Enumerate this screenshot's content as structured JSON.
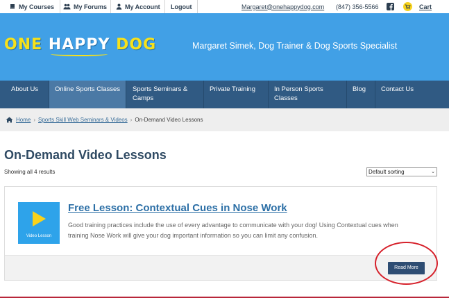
{
  "topbar": {
    "my_courses": "My Courses",
    "my_forums": "My Forums",
    "my_account": "My Account",
    "logout": "Logout",
    "email": "Margaret@onehappydog.com",
    "phone": "(847) 356-5566",
    "cart": "Cart"
  },
  "header": {
    "logo_one": "ONE",
    "logo_happy": "HAPPY",
    "logo_dog": "DOG",
    "tagline": "Margaret Simek, Dog Trainer & Dog Sports Specialist",
    "bg_color": "#41a0e6",
    "logo_color": "#f7e11a"
  },
  "nav": {
    "items": [
      {
        "label": "About Us"
      },
      {
        "label": "Online Sports Classes"
      },
      {
        "label": "Sports Seminars & Camps"
      },
      {
        "label": "Private Training"
      },
      {
        "label": "In Person Sports Classes"
      },
      {
        "label": "Blog"
      },
      {
        "label": "Contact Us"
      }
    ],
    "active_index": 1,
    "bg_color": "#305a83"
  },
  "breadcrumb": {
    "home": "Home",
    "parent": "Sports Skill Web Seminars & Videos",
    "current": "On-Demand Video Lessons"
  },
  "main": {
    "title": "On-Demand Video Lessons",
    "result_count": "Showing all 4 results",
    "sort_value": "Default sorting"
  },
  "product": {
    "thumb_label": "Video Lesson",
    "title": "Free Lesson: Contextual Cues in Nose Work",
    "description": "Good training practices include the use of every advantage to communicate with your dog! Using Contextual cues when training Nose Work will give your dog important information so you can limit any confusion.",
    "button_label": "Read More"
  }
}
